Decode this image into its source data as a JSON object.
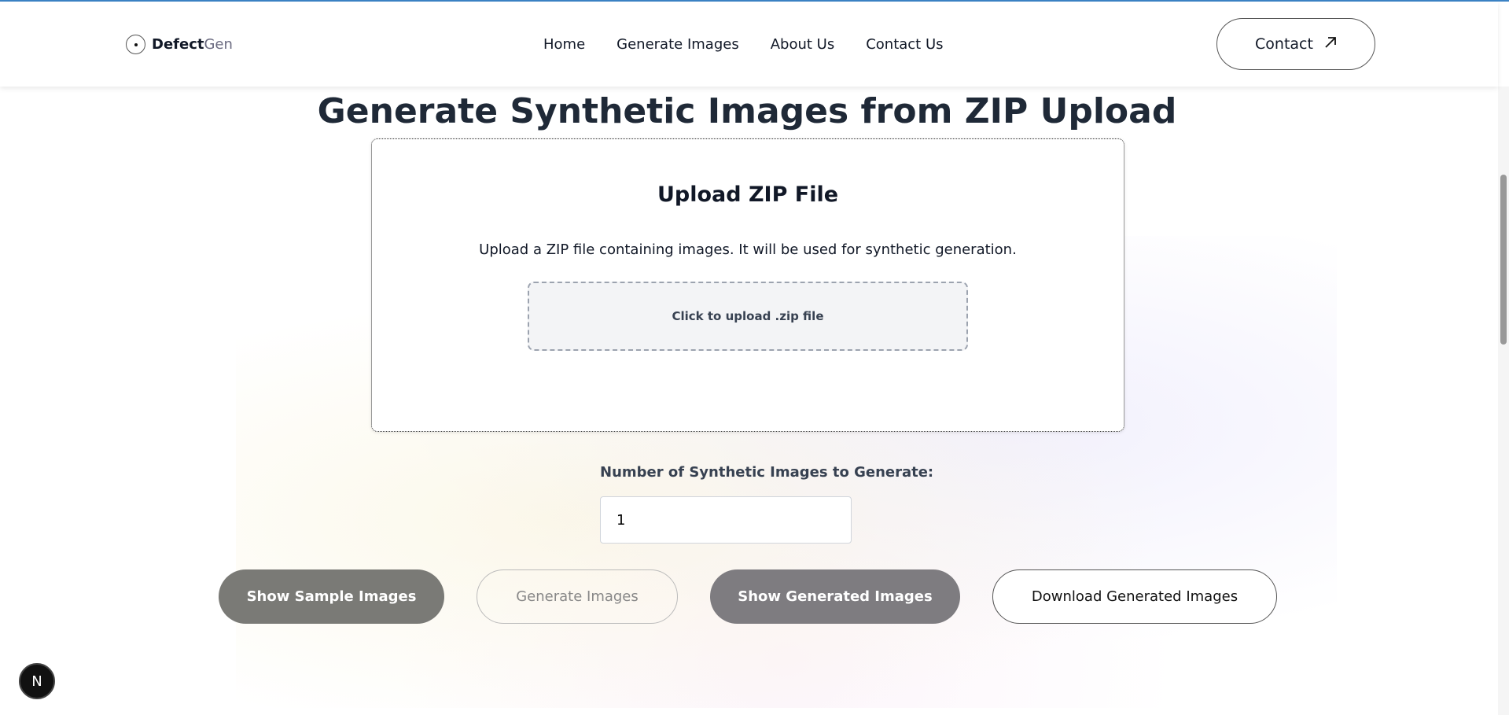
{
  "header": {
    "logo_main": "Defect",
    "logo_accent": "Gen",
    "nav": [
      "Home",
      "Generate Images",
      "About Us",
      "Contact Us"
    ],
    "contact_label": "Contact"
  },
  "page_title": "Generate Synthetic Images from ZIP Upload",
  "upload": {
    "heading": "Upload ZIP File",
    "description": "Upload a ZIP file containing images. It will be used for synthetic generation.",
    "dropzone": "Click to upload .zip file"
  },
  "count": {
    "label": "Number of Synthetic Images to Generate:",
    "value": "1"
  },
  "buttons": {
    "sample": "Show Sample Images",
    "generate": "Generate Images",
    "show_generated": "Show Generated Images",
    "download": "Download Generated Images"
  },
  "badge": "N"
}
